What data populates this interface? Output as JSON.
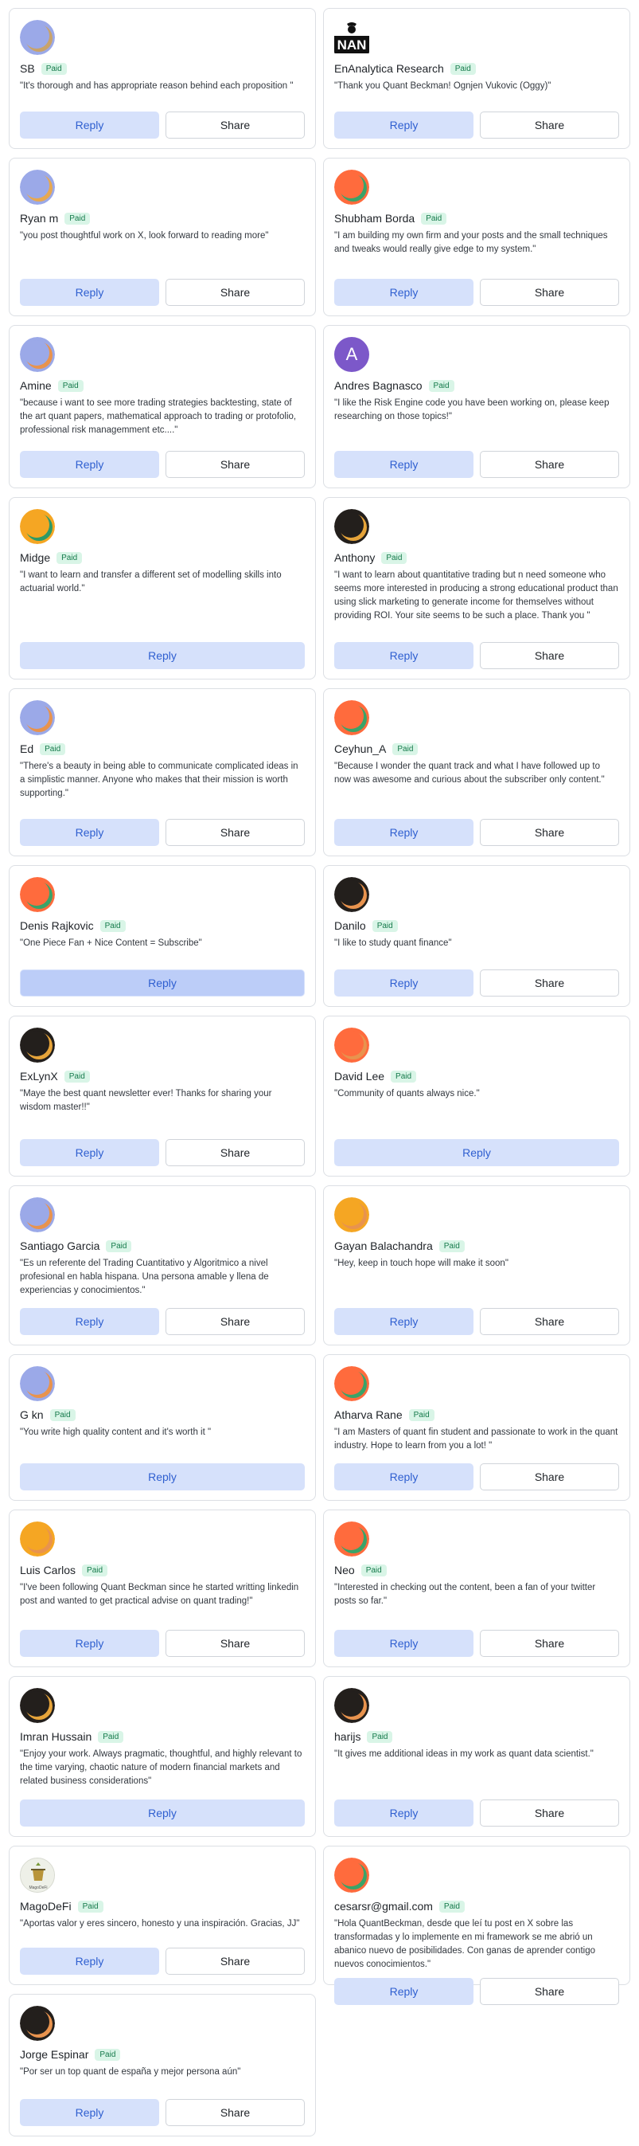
{
  "labels": {
    "paid": "Paid",
    "reply": "Reply",
    "share": "Share"
  },
  "cards": [
    {
      "name": "SB",
      "quote": "\"It's thorough and has appropriate reason behind each proposition \"",
      "avatar": "ring",
      "ring": "#9ba9e8",
      "inner": "#c9a36a",
      "share": true
    },
    {
      "name": "EnAnalytica Research",
      "quote": "\"Thank you Quant Beckman! Ognjen Vukovic (Oggy)\"",
      "avatar": "logo",
      "logo_text": "NAN",
      "share": true
    },
    {
      "name": "Ryan m",
      "quote": "\"you post thoughtful work on X, look forward to reading more\"",
      "avatar": "ring",
      "ring": "#9ba9e8",
      "inner": "#e7a850",
      "share": true
    },
    {
      "name": "Shubham Borda",
      "quote": "\"I am building my own firm and your posts and the small techniques and tweaks would really give edge to my system.\"",
      "avatar": "ring",
      "ring": "#ff6b3d",
      "inner": "#3aa368",
      "share": true
    },
    {
      "name": "Amine",
      "quote": "\"because i want to see more trading strategies backtesting, state of the art quant papers, mathematical approach to trading or protofolio, professional risk managemment etc....\"",
      "avatar": "ring",
      "ring": "#9ba9e8",
      "inner": "#e8934e",
      "share": true
    },
    {
      "name": "Andres Bagnasco",
      "quote": "\"I like the Risk Engine code you have been working on, please keep researching on those topics!\"",
      "avatar": "letter",
      "letter": "A",
      "share": true
    },
    {
      "name": "Midge",
      "quote": "\"I want to learn and transfer a different set of modelling skills into actuarial world.\"",
      "avatar": "ring",
      "ring": "#f5a623",
      "inner": "#2e9a66",
      "share": false
    },
    {
      "name": "Anthony",
      "quote": "\"I want to learn about quantitative trading but n need someone who seems more interested in producing a strong educational product than using slick marketing to generate income for themselves without providing ROI. Your site seems to be such a place. Thank you \"",
      "avatar": "ring",
      "ring": "#231f1c",
      "inner": "#e6a43a",
      "share": true
    },
    {
      "name": "Ed",
      "quote": "\"There's a beauty in being able to communicate complicated ideas in a simplistic manner. Anyone who makes that their mission is worth supporting.\"",
      "avatar": "ring",
      "ring": "#9ba9e8",
      "inner": "#e8934e",
      "share": true
    },
    {
      "name": "Ceyhun_A",
      "quote": "\"Because I wonder the quant track and what I have followed up to now was awesome and curious about the subscriber only content.\"",
      "avatar": "ring",
      "ring": "#ff6b3d",
      "inner": "#3aa368",
      "share": true
    },
    {
      "name": "Denis Rajkovic",
      "quote": "\"One Piece Fan + Nice Content = Subscribe\"",
      "avatar": "ring",
      "ring": "#ff6b3d",
      "inner": "#3aa368",
      "share": false,
      "active": true
    },
    {
      "name": "Danilo",
      "quote": "\"I like to study quant finance\"",
      "avatar": "ring",
      "ring": "#231f1c",
      "inner": "#e8934e",
      "share": true
    },
    {
      "name": "ExLynX",
      "quote": "\"Maye the best quant newsletter ever! Thanks for sharing your wisdom master!!\"",
      "avatar": "ring",
      "ring": "#231f1c",
      "inner": "#e6a43a",
      "share": true
    },
    {
      "name": "David Lee",
      "quote": "\"Community of quants always nice.\"",
      "avatar": "ring",
      "ring": "#ff6b3d",
      "inner": "#e8934e",
      "share": false
    },
    {
      "name": "Santiago Garcia",
      "quote": "\"Es un referente del Trading Cuantitativo y Algoritmico a nivel profesional en habla hispana. Una persona amable y llena de experiencias y conocimientos.\"",
      "avatar": "ring",
      "ring": "#9ba9e8",
      "inner": "#e8934e",
      "share": true
    },
    {
      "name": "Gayan Balachandra",
      "quote": "\"Hey, keep in touch hope will make it soon\"",
      "avatar": "ring",
      "ring": "#f5a623",
      "inner": "#e8934e",
      "share": true
    },
    {
      "name": "G kn",
      "quote": "\"You write high quality content and it's worth it \"",
      "avatar": "ring",
      "ring": "#9ba9e8",
      "inner": "#e8934e",
      "share": false
    },
    {
      "name": "Atharva Rane",
      "quote": "\"I am Masters of quant fin student and passionate to work in the quant industry. Hope to learn from you a lot! \"",
      "avatar": "ring",
      "ring": "#ff6b3d",
      "inner": "#3aa368",
      "share": true
    },
    {
      "name": "Luis Carlos",
      "quote": "\"I've been following Quant Beckman since he started writting linkedin post and wanted to get practical advise on quant trading!\"",
      "avatar": "ring",
      "ring": "#f5a623",
      "inner": "#e8934e",
      "share": true
    },
    {
      "name": "Neo",
      "quote": "\"Interested in checking out the content, been a fan of your twitter posts so far.\"",
      "avatar": "ring",
      "ring": "#ff6b3d",
      "inner": "#3aa368",
      "share": true
    },
    {
      "name": "Imran Hussain",
      "quote": "\"Enjoy your work. Always pragmatic, thoughtful, and highly relevant to the time varying, chaotic nature of modern financial markets and related business considerations\"",
      "avatar": "ring",
      "ring": "#231f1c",
      "inner": "#e6a43a",
      "share": false
    },
    {
      "name": "harijs",
      "quote": "\"It gives me additional ideas in my work as quant data scientist.\"",
      "avatar": "ring",
      "ring": "#231f1c",
      "inner": "#e8934e",
      "share": true
    },
    {
      "name": "MagoDeFi",
      "quote": "\"Aportas valor y eres sincero, honesto y una inspiración. Gracias, JJ\"",
      "avatar": "image",
      "share": true
    },
    {
      "name": "cesarsr@gmail.com",
      "quote": "\"Hola QuantBeckman, desde que leí tu post en X sobre las transformadas y lo implemente en mi framework se me abrió un abanico nuevo de posibilidades. Con ganas de aprender contigo nuevos conocimientos.\"",
      "avatar": "ring",
      "ring": "#ff6b3d",
      "inner": "#3aa368",
      "share": true
    },
    {
      "name": "Jorge Espinar",
      "quote": "\"Por ser un top quant de españa y mejor persona aún\"",
      "avatar": "ring",
      "ring": "#231f1c",
      "inner": "#e8934e",
      "share": true
    }
  ]
}
